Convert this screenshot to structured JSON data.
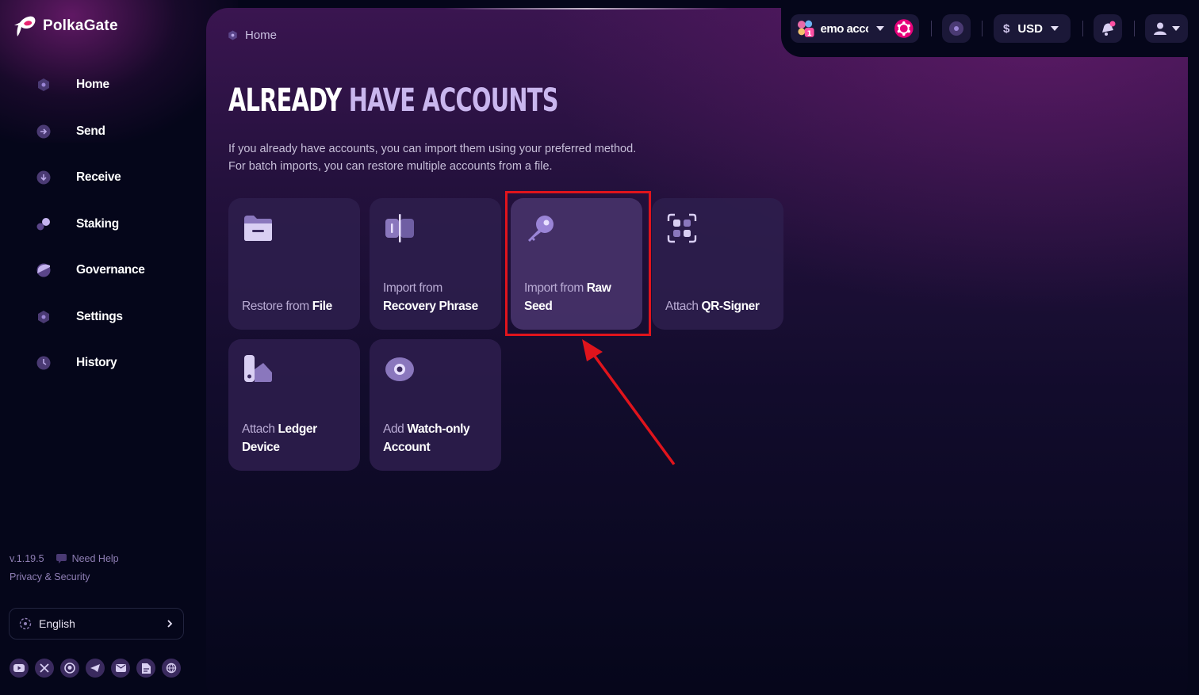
{
  "app": {
    "name": "PolkaGate",
    "version": "v.1.19.5"
  },
  "nav": {
    "items": [
      {
        "label": "Home",
        "icon": "home-icon"
      },
      {
        "label": "Send",
        "icon": "send-icon"
      },
      {
        "label": "Receive",
        "icon": "receive-icon"
      },
      {
        "label": "Staking",
        "icon": "staking-icon"
      },
      {
        "label": "Governance",
        "icon": "governance-icon"
      },
      {
        "label": "Settings",
        "icon": "settings-icon"
      },
      {
        "label": "History",
        "icon": "history-icon"
      }
    ]
  },
  "sidebar": {
    "help_label": "Need Help",
    "privacy_label": "Privacy & Security",
    "language": "English",
    "socials": [
      "youtube-icon",
      "x-icon",
      "github-icon",
      "telegram-icon",
      "email-icon",
      "docs-icon",
      "web-icon"
    ]
  },
  "header": {
    "account_label": "emo acco",
    "account_badge": "1",
    "currency_symbol": "$",
    "currency": "USD"
  },
  "breadcrumb": {
    "label": "Home"
  },
  "page": {
    "title_part1": "ALREADY",
    "title_part2": "HAVE ACCOUNTS",
    "description": "If you already have accounts, you can import them using your preferred method. For batch imports, you can restore multiple accounts from a file."
  },
  "options": [
    {
      "light": "Restore from",
      "bold": "File",
      "icon": "folder-icon"
    },
    {
      "light": "Import from",
      "bold": "Recovery Phrase",
      "icon": "recovery-phrase-icon"
    },
    {
      "light": "Import from",
      "bold": "Raw Seed",
      "icon": "key-icon",
      "highlighted": true
    },
    {
      "light": "Attach",
      "bold": "QR-Signer",
      "icon": "qr-scan-icon"
    },
    {
      "light": "Attach",
      "bold": "Ledger Device",
      "icon": "ledger-icon"
    },
    {
      "light": "Add",
      "bold": "Watch-only Account",
      "icon": "eye-icon"
    }
  ],
  "colors": {
    "accent": "#e0141c",
    "highlight_border": "#e0141c",
    "brand_pink": "#ff4fa3",
    "card_bg": "#2e1f4d"
  }
}
